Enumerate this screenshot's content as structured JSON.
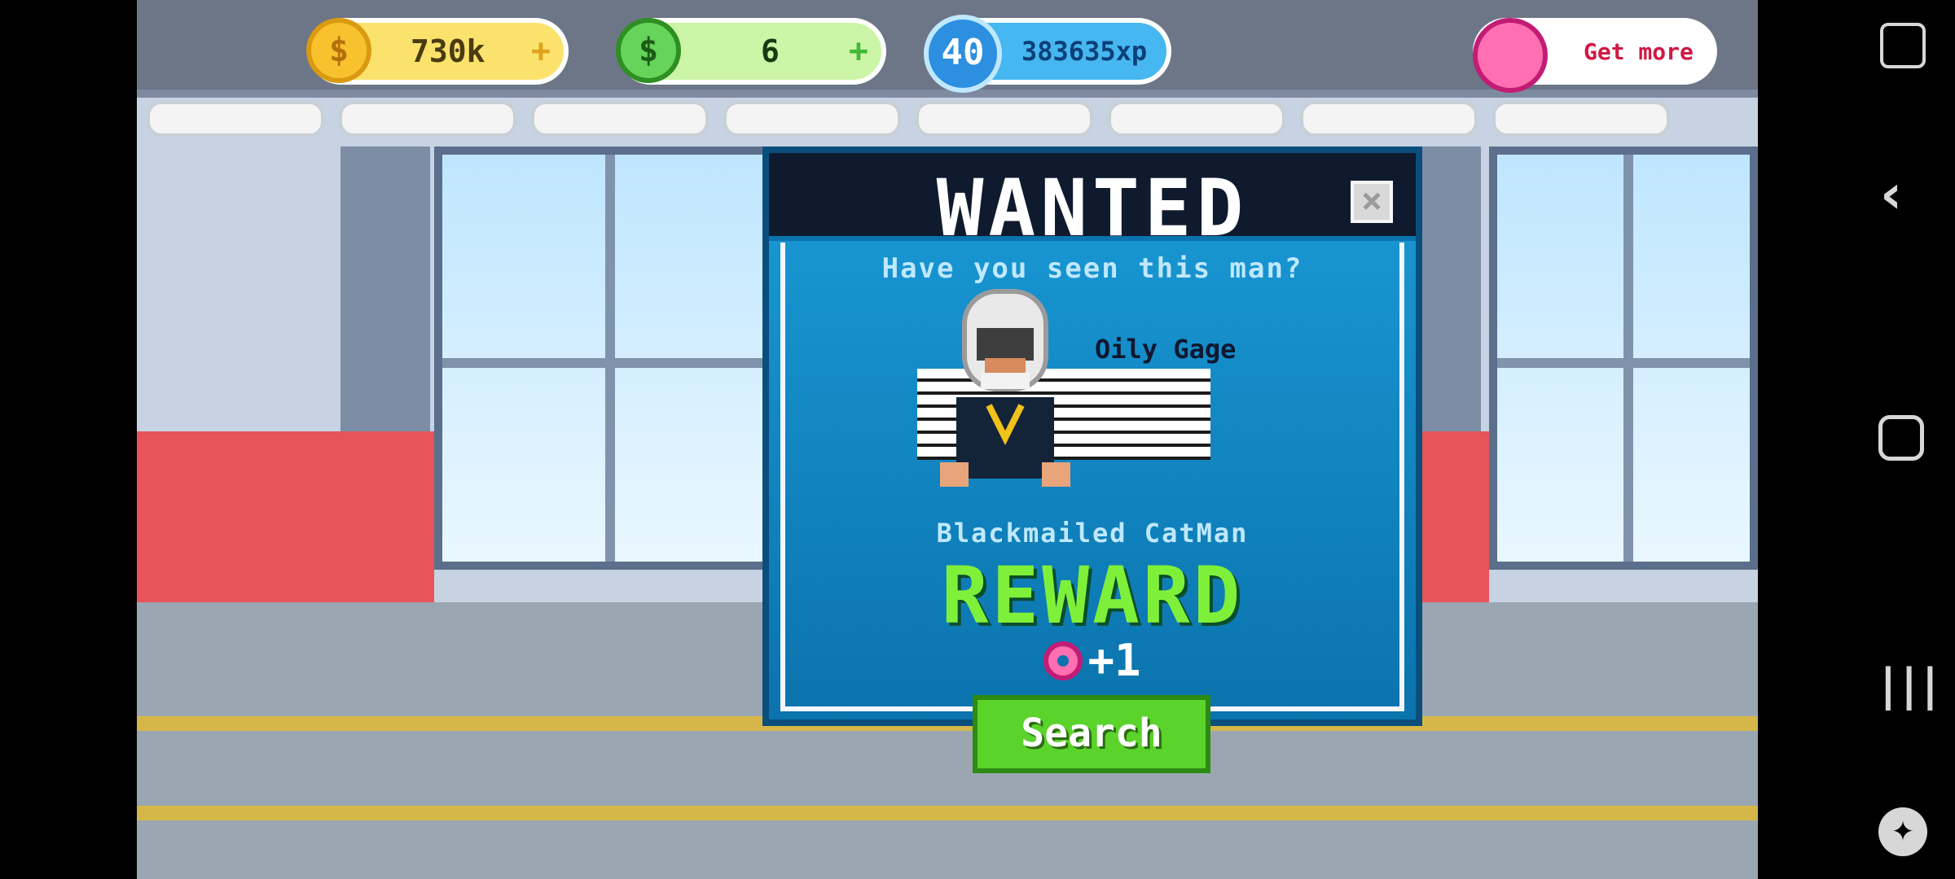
{
  "hud": {
    "coins": "730k",
    "cash": "6",
    "level": "40",
    "xp": "383635xp",
    "donuts_cta": "Get more"
  },
  "wanted": {
    "title": "WANTED",
    "close_label": "×",
    "subtitle": "Have you seen this man?",
    "suspect_name": "Oily Gage",
    "crime": "Blackmailed CatMan",
    "reward_label": "REWARD",
    "reward_value": "+1",
    "button": "Search"
  },
  "colors": {
    "panel": "#1a9bd7",
    "reward_green": "#7ff03a",
    "button_green": "#5ad32a"
  },
  "icons": {
    "coin": "coin-icon",
    "cash": "cash-icon",
    "level": "level-badge",
    "donut": "donut-icon",
    "close": "close-icon",
    "nav_back": "back-icon",
    "nav_home": "home-icon",
    "nav_recents": "recents-icon",
    "game_tools": "gamepad-icon",
    "screen_hint": "touch-icon"
  }
}
